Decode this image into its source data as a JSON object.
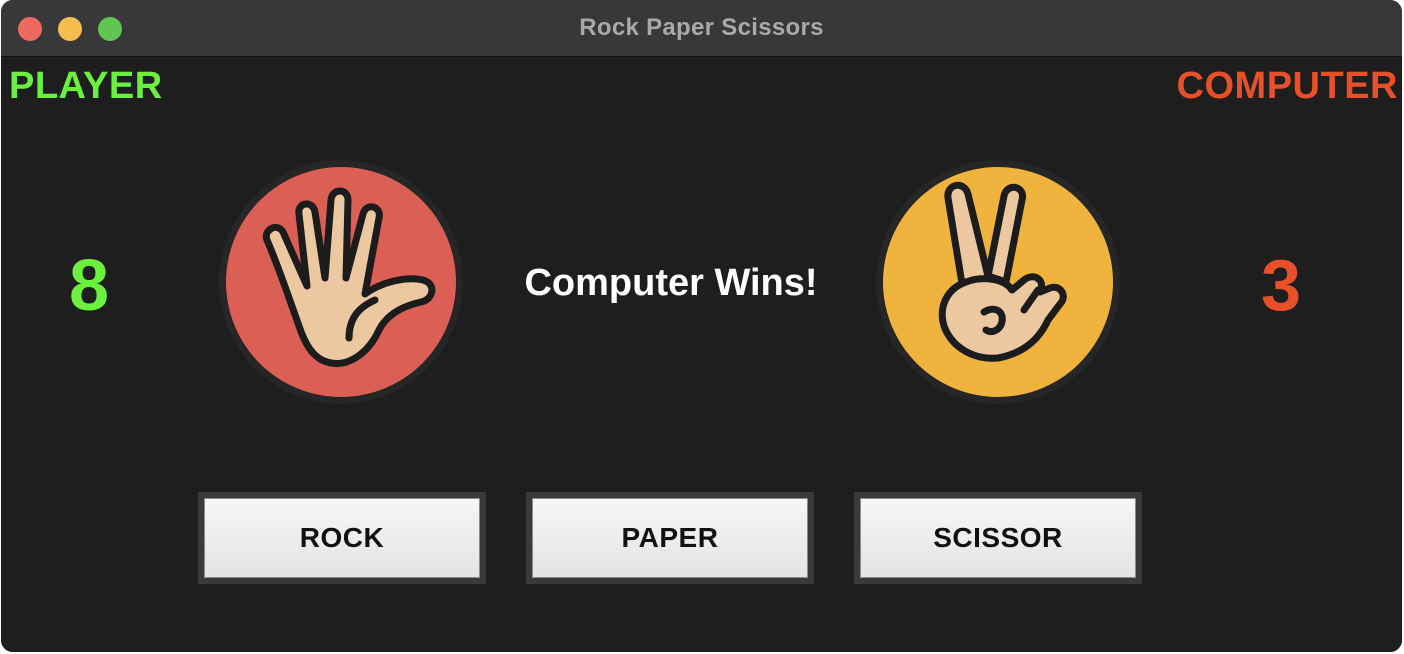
{
  "window": {
    "title": "Rock Paper Scissors",
    "controls": [
      "close",
      "minimize",
      "zoom"
    ]
  },
  "labels": {
    "player": "PLAYER",
    "computer": "COMPUTER"
  },
  "scores": {
    "player": "8",
    "computer": "3"
  },
  "result": "Computer Wins!",
  "choices": {
    "player": {
      "icon": "paper-hand-icon",
      "color": "#dc5f55"
    },
    "computer": {
      "icon": "scissors-hand-icon",
      "color": "#f0b43e"
    }
  },
  "buttons": {
    "rock": "ROCK",
    "paper": "PAPER",
    "scissor": "SCISSOR"
  },
  "colors": {
    "player": "#6cf040",
    "computer": "#e8502a",
    "background": "#1e1e1e"
  }
}
